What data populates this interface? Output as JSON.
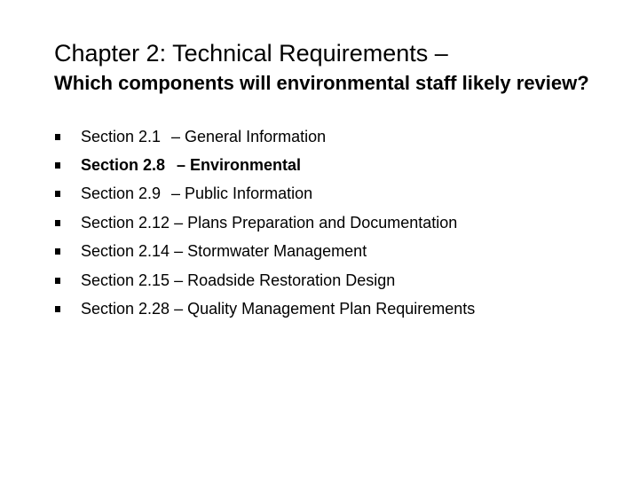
{
  "slide": {
    "title": "Chapter 2: Technical Requirements –",
    "subtitle": "Which components will environmental staff likely review?",
    "bullets": [
      {
        "section": "Section 2.1",
        "description": "– General Information",
        "bold": false
      },
      {
        "section": "Section 2.8",
        "description": "– Environmental",
        "bold": true
      },
      {
        "section": "Section 2.9",
        "description": "– Public Information",
        "bold": false
      },
      {
        "section": "Section 2.12",
        "description": "– Plans Preparation and Documentation",
        "bold": false
      },
      {
        "section": "Section 2.14",
        "description": "– Stormwater Management",
        "bold": false
      },
      {
        "section": "Section 2.15",
        "description": "– Roadside Restoration Design",
        "bold": false
      },
      {
        "section": "Section 2.28",
        "description": "– Quality Management Plan Requirements",
        "bold": false
      }
    ],
    "bullet_icon": "square-bullet-icon"
  }
}
